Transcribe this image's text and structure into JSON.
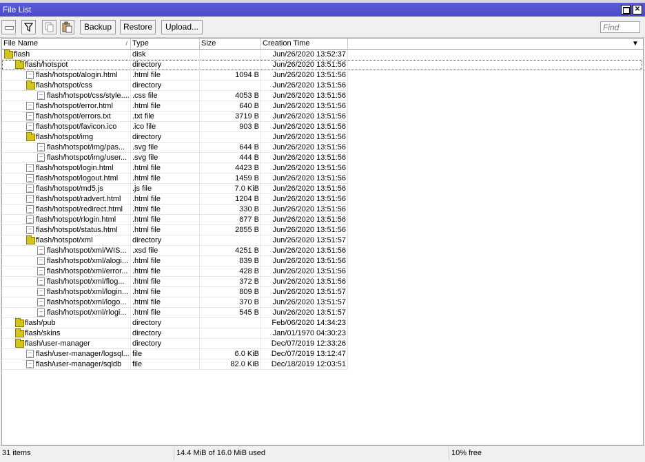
{
  "window": {
    "title": "File List"
  },
  "toolbar": {
    "backup_label": "Backup",
    "restore_label": "Restore",
    "upload_label": "Upload...",
    "find_placeholder": "Find"
  },
  "columns": {
    "name": "File Name",
    "type": "Type",
    "size": "Size",
    "time": "Creation Time"
  },
  "rows": [
    {
      "name": "flash",
      "type": "disk",
      "size": "",
      "time": "Jun/26/2020 13:52:37",
      "icon": "folder",
      "level": 0
    },
    {
      "name": "flash/hotspot",
      "type": "directory",
      "size": "",
      "time": "Jun/26/2020 13:51:56",
      "icon": "folder",
      "level": 1,
      "selected": true
    },
    {
      "name": "flash/hotspot/alogin.html",
      "type": ".html file",
      "size": "1094 B",
      "time": "Jun/26/2020 13:51:56",
      "icon": "file",
      "level": 2
    },
    {
      "name": "flash/hotspot/css",
      "type": "directory",
      "size": "",
      "time": "Jun/26/2020 13:51:56",
      "icon": "folder",
      "level": 2
    },
    {
      "name": "flash/hotspot/css/style....",
      "type": ".css file",
      "size": "4053 B",
      "time": "Jun/26/2020 13:51:56",
      "icon": "file",
      "level": 3
    },
    {
      "name": "flash/hotspot/error.html",
      "type": ".html file",
      "size": "640 B",
      "time": "Jun/26/2020 13:51:56",
      "icon": "file",
      "level": 2
    },
    {
      "name": "flash/hotspot/errors.txt",
      "type": ".txt file",
      "size": "3719 B",
      "time": "Jun/26/2020 13:51:56",
      "icon": "file",
      "level": 2
    },
    {
      "name": "flash/hotspot/favicon.ico",
      "type": ".ico file",
      "size": "903 B",
      "time": "Jun/26/2020 13:51:56",
      "icon": "file",
      "level": 2
    },
    {
      "name": "flash/hotspot/img",
      "type": "directory",
      "size": "",
      "time": "Jun/26/2020 13:51:56",
      "icon": "folder",
      "level": 2
    },
    {
      "name": "flash/hotspot/img/pas...",
      "type": ".svg file",
      "size": "644 B",
      "time": "Jun/26/2020 13:51:56",
      "icon": "file",
      "level": 3
    },
    {
      "name": "flash/hotspot/img/user...",
      "type": ".svg file",
      "size": "444 B",
      "time": "Jun/26/2020 13:51:56",
      "icon": "file",
      "level": 3
    },
    {
      "name": "flash/hotspot/login.html",
      "type": ".html file",
      "size": "4423 B",
      "time": "Jun/26/2020 13:51:56",
      "icon": "file",
      "level": 2
    },
    {
      "name": "flash/hotspot/logout.html",
      "type": ".html file",
      "size": "1459 B",
      "time": "Jun/26/2020 13:51:56",
      "icon": "file",
      "level": 2
    },
    {
      "name": "flash/hotspot/md5.js",
      "type": ".js file",
      "size": "7.0 KiB",
      "time": "Jun/26/2020 13:51:56",
      "icon": "file",
      "level": 2
    },
    {
      "name": "flash/hotspot/radvert.html",
      "type": ".html file",
      "size": "1204 B",
      "time": "Jun/26/2020 13:51:56",
      "icon": "file",
      "level": 2
    },
    {
      "name": "flash/hotspot/redirect.html",
      "type": ".html file",
      "size": "330 B",
      "time": "Jun/26/2020 13:51:56",
      "icon": "file",
      "level": 2
    },
    {
      "name": "flash/hotspot/rlogin.html",
      "type": ".html file",
      "size": "877 B",
      "time": "Jun/26/2020 13:51:56",
      "icon": "file",
      "level": 2
    },
    {
      "name": "flash/hotspot/status.html",
      "type": ".html file",
      "size": "2855 B",
      "time": "Jun/26/2020 13:51:56",
      "icon": "file",
      "level": 2
    },
    {
      "name": "flash/hotspot/xml",
      "type": "directory",
      "size": "",
      "time": "Jun/26/2020 13:51:57",
      "icon": "folder",
      "level": 2
    },
    {
      "name": "flash/hotspot/xml/WIS...",
      "type": ".xsd file",
      "size": "4251 B",
      "time": "Jun/26/2020 13:51:56",
      "icon": "file",
      "level": 3
    },
    {
      "name": "flash/hotspot/xml/alogi...",
      "type": ".html file",
      "size": "839 B",
      "time": "Jun/26/2020 13:51:56",
      "icon": "file",
      "level": 3
    },
    {
      "name": "flash/hotspot/xml/error...",
      "type": ".html file",
      "size": "428 B",
      "time": "Jun/26/2020 13:51:56",
      "icon": "file",
      "level": 3
    },
    {
      "name": "flash/hotspot/xml/flog...",
      "type": ".html file",
      "size": "372 B",
      "time": "Jun/26/2020 13:51:56",
      "icon": "file",
      "level": 3
    },
    {
      "name": "flash/hotspot/xml/login...",
      "type": ".html file",
      "size": "809 B",
      "time": "Jun/26/2020 13:51:57",
      "icon": "file",
      "level": 3
    },
    {
      "name": "flash/hotspot/xml/logo...",
      "type": ".html file",
      "size": "370 B",
      "time": "Jun/26/2020 13:51:57",
      "icon": "file",
      "level": 3
    },
    {
      "name": "flash/hotspot/xml/rlogi...",
      "type": ".html file",
      "size": "545 B",
      "time": "Jun/26/2020 13:51:57",
      "icon": "file",
      "level": 3
    },
    {
      "name": "flash/pub",
      "type": "directory",
      "size": "",
      "time": "Feb/06/2020 14:34:23",
      "icon": "folder",
      "level": 1
    },
    {
      "name": "flash/skins",
      "type": "directory",
      "size": "",
      "time": "Jan/01/1970 04:30:23",
      "icon": "folder",
      "level": 1
    },
    {
      "name": "flash/user-manager",
      "type": "directory",
      "size": "",
      "time": "Dec/07/2019 12:33:26",
      "icon": "folder",
      "level": 1
    },
    {
      "name": "flash/user-manager/logsql...",
      "type": "file",
      "size": "6.0 KiB",
      "time": "Dec/07/2019 13:12:47",
      "icon": "file",
      "level": 2
    },
    {
      "name": "flash/user-manager/sqldb",
      "type": "file",
      "size": "82.0 KiB",
      "time": "Dec/18/2019 12:03:51",
      "icon": "file",
      "level": 2
    }
  ],
  "status": {
    "items": "31 items",
    "usage": "14.4 MiB of 16.0 MiB used",
    "free": "10% free"
  }
}
